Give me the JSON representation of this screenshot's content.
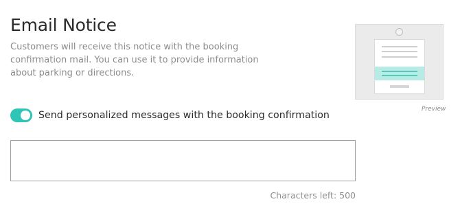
{
  "section": {
    "title": "Email Notice",
    "description": "Customers will receive this notice with the booking confirmation mail. You can use it to provide information about parking or directions."
  },
  "preview": {
    "label": "Preview",
    "accent_color": "#b7ebe5"
  },
  "toggle": {
    "label": "Send personalized messages with the booking confirmation",
    "checked": true,
    "color": "#2ec4b6"
  },
  "message": {
    "value": "",
    "placeholder": ""
  },
  "counter": {
    "text": "Characters left: 500"
  }
}
